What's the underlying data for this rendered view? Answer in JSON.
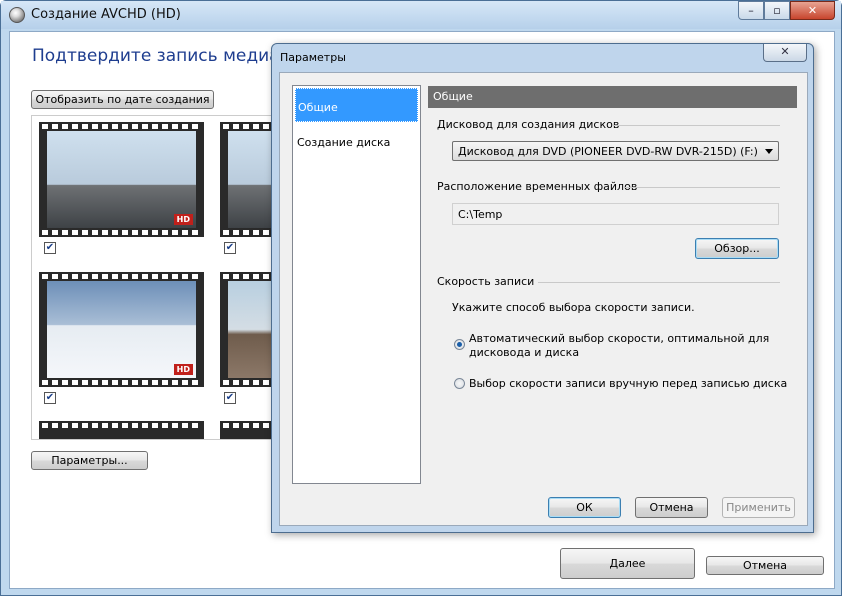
{
  "window": {
    "title": "Создание AVCHD (HD)",
    "caption_buttons": {
      "minimize": "–",
      "maximize": "▫",
      "close": "✕"
    }
  },
  "main": {
    "heading": "Подтвердите запись медиафайлов и порядок их воспроизведения.",
    "sort_button": "Отобразить по дате создания",
    "params_button": "Параметры...",
    "next_button": "Далее",
    "cancel_button": "Отмена",
    "thumbnails": [
      {
        "badge": "HD",
        "checked": true
      },
      {
        "badge": "",
        "checked": true
      },
      {
        "badge": "HD",
        "checked": true
      },
      {
        "badge": "",
        "checked": true
      }
    ],
    "check_mark": "✔"
  },
  "dialog": {
    "title": "Параметры",
    "close": "✕",
    "nav": [
      "Общие",
      "Создание диска"
    ],
    "section_header": "Общие",
    "drive_label": "Дисковод для создания дисков",
    "drive_value": "Дисковод для DVD (PIONEER DVD-RW  DVR-215D) (F:)",
    "temp_label": "Расположение временных файлов",
    "temp_value": "C:\\Temp",
    "browse_button": "Обзор...",
    "speed_label": "Скорость записи",
    "speed_hint": "Укажите способ выбора скорости записи.",
    "radio_auto_line1": "Автоматический выбор скорости, оптимальной для",
    "radio_auto_line2": "дисковода и диска",
    "radio_manual": "Выбор скорости записи вручную перед записью диска",
    "ok_button": "ОК",
    "cancel_button": "Отмена",
    "apply_button": "Применить"
  }
}
